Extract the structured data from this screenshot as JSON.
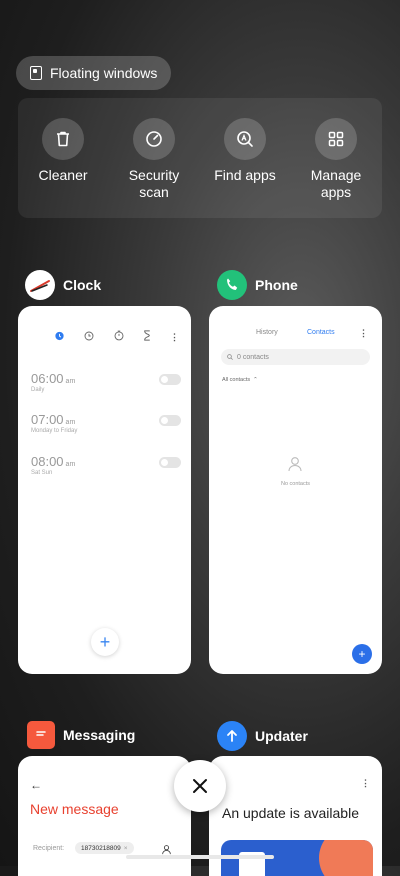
{
  "floating_windows": {
    "label": "Floating windows",
    "icon": "floating-window-icon"
  },
  "tools": [
    {
      "label": "Cleaner",
      "icon": "trash-icon"
    },
    {
      "label": "Security scan",
      "icon": "gauge-icon"
    },
    {
      "label": "Find apps",
      "icon": "search-apps-icon"
    },
    {
      "label": "Manage apps",
      "icon": "grid-icon"
    }
  ],
  "apps": {
    "clock": {
      "name": "Clock",
      "icon_bg": "#ffffff",
      "alarms": [
        {
          "time": "06:00",
          "ampm": "am",
          "repeat": "Daily"
        },
        {
          "time": "07:00",
          "ampm": "am",
          "repeat": "Monday to Friday"
        },
        {
          "time": "08:00",
          "ampm": "am",
          "repeat": "Sat Sun"
        }
      ],
      "add": "+"
    },
    "phone": {
      "name": "Phone",
      "icon_bg": "#22c17a",
      "tab_history": "History",
      "tab_contacts": "Contacts",
      "search": "0 contacts",
      "filter": "All contacts",
      "empty": "No contacts",
      "add": "+"
    },
    "messaging": {
      "name": "Messaging",
      "icon_bg": "#f5593d",
      "title": "New message",
      "recipient_label": "Recipient:",
      "recipient_chip": "18730218809"
    },
    "updater": {
      "name": "Updater",
      "icon_bg": "#2b83f6",
      "message": "An update is available"
    }
  },
  "colors": {
    "accent_blue": "#2f7cf0",
    "message_red": "#e8412f"
  }
}
